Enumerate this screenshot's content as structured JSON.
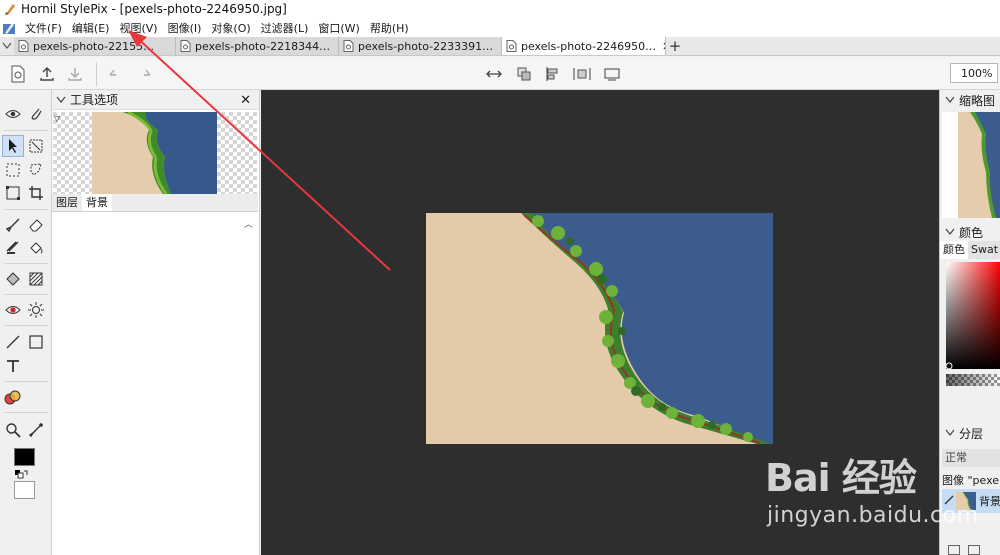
{
  "window": {
    "title": "Hornil StylePix - [pexels-photo-2246950.jpg]"
  },
  "menu": [
    {
      "label": "文件(F)"
    },
    {
      "label": "编辑(E)"
    },
    {
      "label": "视图(V)"
    },
    {
      "label": "图像(I)"
    },
    {
      "label": "对象(O)"
    },
    {
      "label": "过滤器(L)"
    },
    {
      "label": "窗口(W)"
    },
    {
      "label": "帮助(H)"
    }
  ],
  "tabs": [
    {
      "label": "pexels-photo-22155…"
    },
    {
      "label": "pexels-photo-2218344…"
    },
    {
      "label": "pexels-photo-2233391…"
    },
    {
      "label": "pexels-photo-2246950…",
      "close": "✕"
    }
  ],
  "new_tab": "+",
  "toolbar": {
    "zoom": "100%"
  },
  "tool_options": {
    "title": "工具选项",
    "close": "✕",
    "tabs": [
      "图层",
      "背景"
    ]
  },
  "right_panels": {
    "thumbnail": {
      "title": "缩略图"
    },
    "color": {
      "title": "颜色",
      "tabs": [
        "颜色",
        "Swat"
      ]
    },
    "layers": {
      "title": "分层",
      "blend_mode": "正常",
      "layer_group": "图像 \"pexel",
      "layer_name": "背景"
    }
  },
  "watermark": {
    "logo": "Bai 经验",
    "url": "jingyan.baidu.com"
  },
  "colors": {
    "canvas_bg": "#2e2e2e",
    "arrow": "#e8383d",
    "selected_tool": "#cfe0f5",
    "foreground": "#000000",
    "background": "#ffffff"
  }
}
